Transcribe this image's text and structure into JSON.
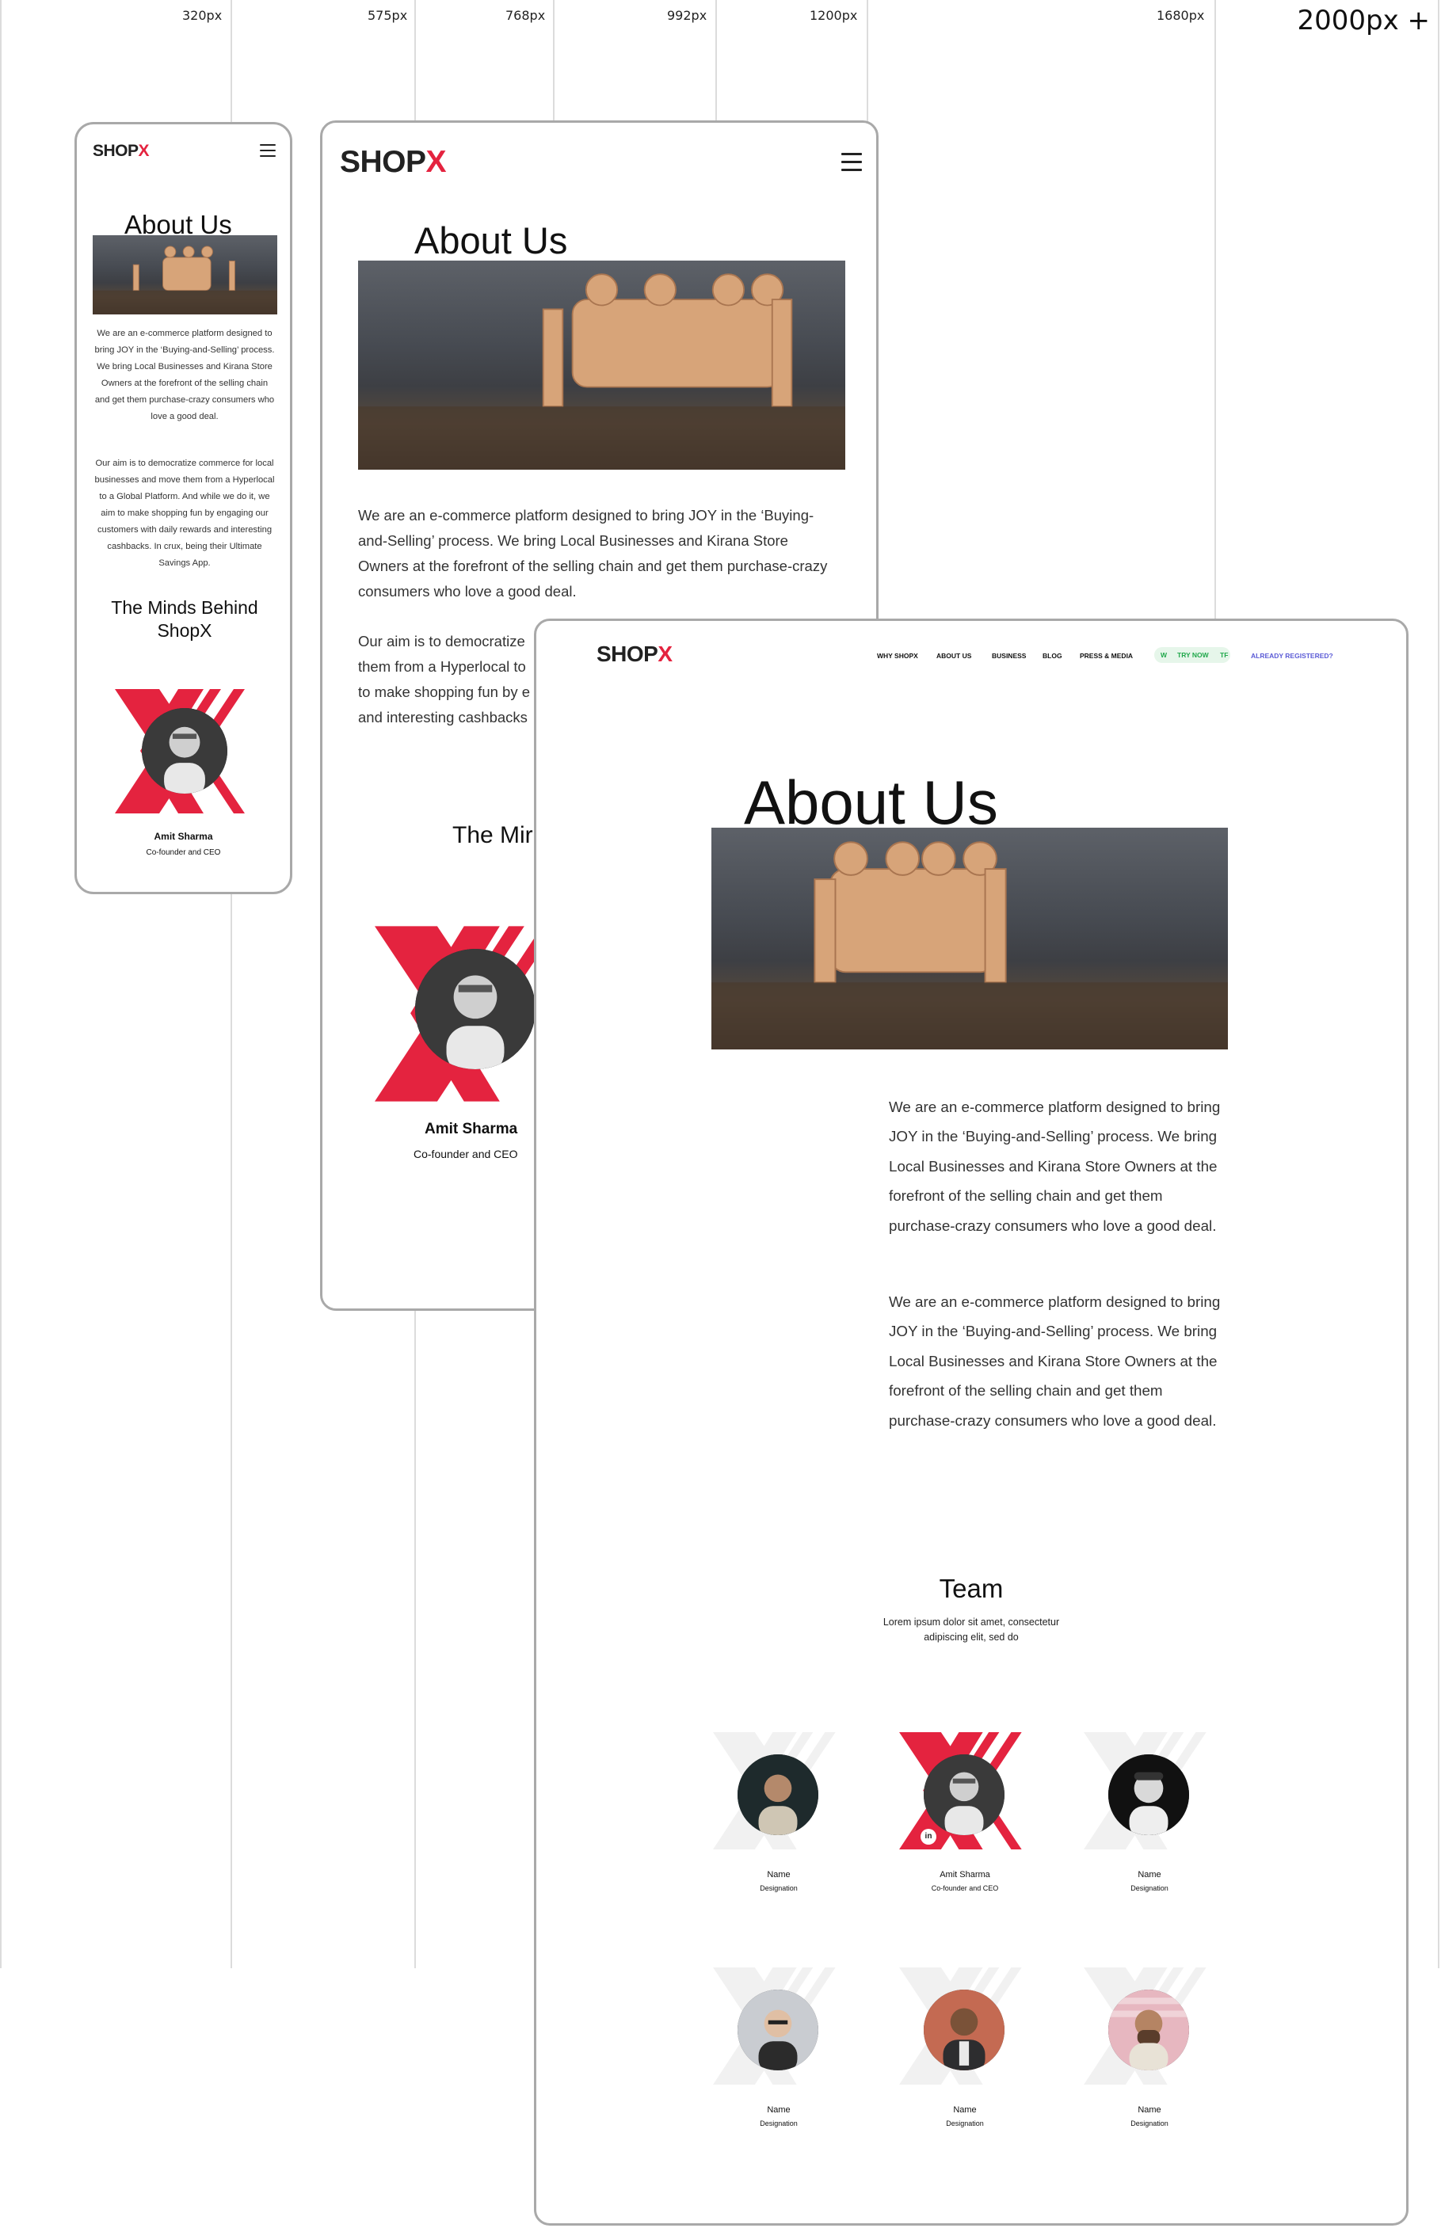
{
  "breakpoints": [
    "320px",
    "575px",
    "768px",
    "992px",
    "1200px",
    "1680px",
    "2000px +"
  ],
  "brand": {
    "logo_text": "SHOP",
    "logo_x": "X",
    "accent": "#e4233f",
    "dark": "#222222"
  },
  "about": {
    "title": "About Us",
    "para1": "We are an e-commerce platform designed to bring JOY in the ‘Buying-and-Selling’ process. We bring Local Businesses and Kirana Store Owners at the forefront of the selling chain and get them purchase-crazy consumers who love a good deal.",
    "para2": "Our aim is to democratize commerce for local businesses and move them from a Hyperlocal to a Global Platform. And while we do it, we aim to make shopping fun by engaging our customers with daily rewards and interesting cashbacks. In crux, being their Ultimate Savings App.",
    "desk_para2": "We are an e-commerce platform designed to bring JOY in the ‘Buying-and-Selling’ process. We bring Local Businesses and Kirana Store Owners at the forefront of the selling chain and get them purchase-crazy consumers who love a good deal."
  },
  "tablet": {
    "para1": "We are an e-commerce platform designed to bring JOY in the ‘Buying-and-Selling’ process. We bring Local Businesses and Kirana Store Owners at the forefront of the selling chain and get them purchase-crazy consumers who love a good deal.",
    "para2_line1": "Our aim is to democratize",
    "para2_line2": "them from a Hyperlocal to",
    "para2_line3": "to make shopping fun by e",
    "para2_line4": "and interesting cashbacks",
    "minds_partial": "The Mir"
  },
  "minds": {
    "heading": "The Minds Behind ShopX"
  },
  "ceo": {
    "name": "Amit Sharma",
    "role": "Co-founder and CEO",
    "linkedin": "in"
  },
  "nav": {
    "items": [
      "WHY SHOPX",
      "ABOUT US",
      "BUSINESS",
      "BLOG",
      "PRESS & MEDIA"
    ],
    "try_left": "W",
    "try_now": "TRY NOW",
    "try_right": "TF",
    "registered": "ALREADY REGISTERED?"
  },
  "team": {
    "heading": "Team",
    "sub1": "Lorem ipsum dolor sit amet, consectetur",
    "sub2": "adipiscing elit, sed do",
    "members": [
      {
        "name": "Name",
        "role": "Designation"
      },
      {
        "name": "Amit Sharma",
        "role": "Co-founder and CEO"
      },
      {
        "name": "Name",
        "role": "Designation"
      },
      {
        "name": "Name",
        "role": "Designation"
      },
      {
        "name": "Name",
        "role": "Designation"
      },
      {
        "name": "Name",
        "role": "Designation"
      }
    ]
  },
  "icons": [
    "menu-icon",
    "linkedin-icon"
  ]
}
